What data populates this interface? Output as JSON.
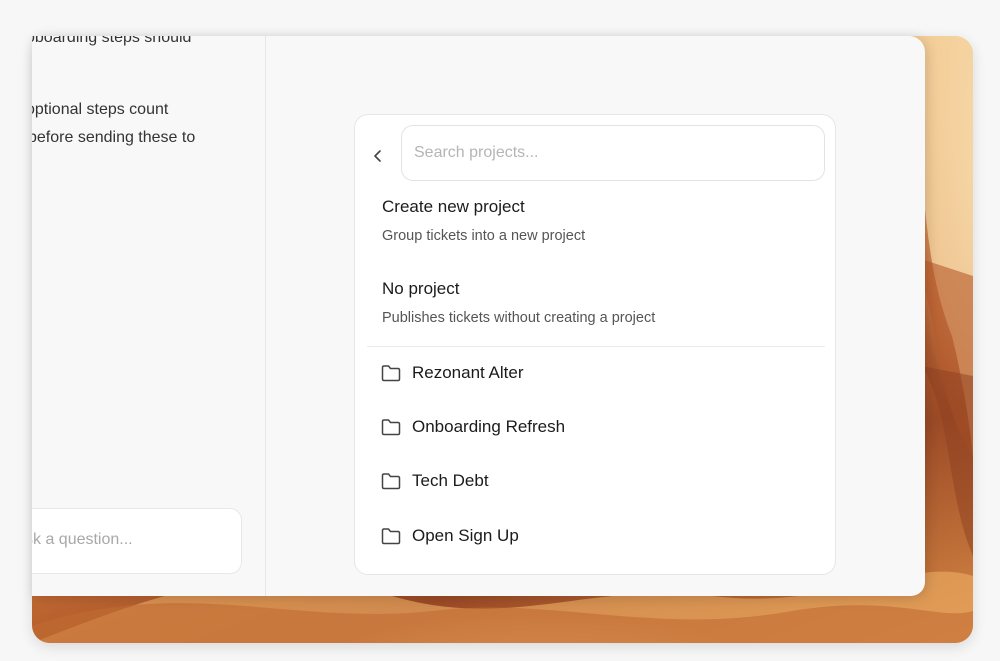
{
  "left_panel": {
    "text_lines": [
      "oboarding steps should",
      "optional steps count",
      "before sending these to"
    ],
    "ask_placeholder": "sk a question..."
  },
  "picker": {
    "search_placeholder": "Search projects...",
    "create_option": {
      "title": "Create new project",
      "description": "Group tickets into a new project"
    },
    "no_project_option": {
      "title": "No project",
      "description": "Publishes tickets without creating a project"
    },
    "projects": [
      {
        "name": "Rezonant Alter",
        "icon": "folder-icon"
      },
      {
        "name": "Onboarding Refresh",
        "icon": "folder-icon"
      },
      {
        "name": "Tech Debt",
        "icon": "folder-icon"
      },
      {
        "name": "Open Sign Up",
        "icon": "folder-icon"
      }
    ]
  },
  "icons": {
    "back": "chevron-left-icon",
    "project": "folder-icon"
  },
  "colors": {
    "window_bg": "#f8f8f8",
    "card_bg": "#ffffff",
    "text": "#1b1b1b",
    "muted": "#555555",
    "placeholder": "#b5b5b5"
  }
}
